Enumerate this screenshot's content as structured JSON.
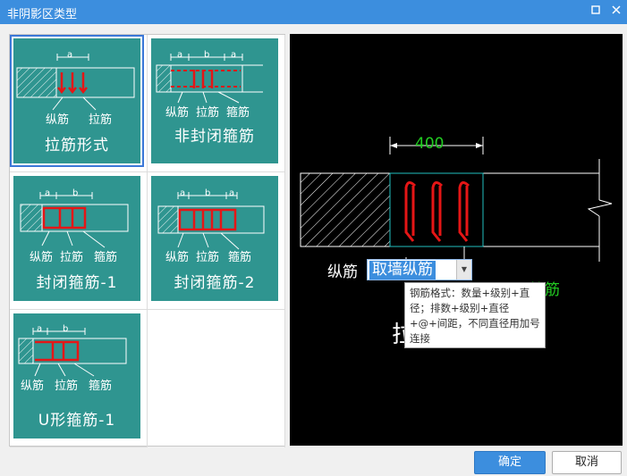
{
  "window": {
    "title": "非阴影区类型"
  },
  "gallery": {
    "items": [
      {
        "label": "拉筋形式",
        "tags": [
          "纵筋",
          "拉筋"
        ],
        "dims": [
          "a"
        ]
      },
      {
        "label": "非封闭箍筋",
        "tags": [
          "纵筋",
          "拉筋",
          "箍筋"
        ],
        "dims": [
          "a",
          "b",
          "a"
        ]
      },
      {
        "label": "封闭箍筋-1",
        "tags": [
          "纵筋",
          "拉筋",
          "箍筋"
        ],
        "dims": [
          "a",
          "b"
        ]
      },
      {
        "label": "封闭箍筋-2",
        "tags": [
          "纵筋",
          "拉筋",
          "箍筋"
        ],
        "dims": [
          "a",
          "b",
          "a"
        ]
      },
      {
        "label": "U形箍筋-1",
        "tags": [
          "纵筋",
          "拉筋",
          "箍筋"
        ],
        "dims": [
          "a",
          "b"
        ]
      }
    ],
    "selected_index": 0
  },
  "preview": {
    "dimension": "400",
    "long_bar_label": "纵筋",
    "combo_value": "取墙纵筋",
    "partial_green_text": "拉筋",
    "partial_white_text": "拉"
  },
  "tooltip": {
    "text": "钢筋格式：数量+级别+直径；排数+级别+直径+@+间距，不同直径用加号连接"
  },
  "buttons": {
    "ok": "确定",
    "cancel": "取消"
  },
  "colors": {
    "accent": "#3c8ede",
    "card": "#2f9590",
    "rebar": "#e51616",
    "dimension": "#22cc22"
  }
}
